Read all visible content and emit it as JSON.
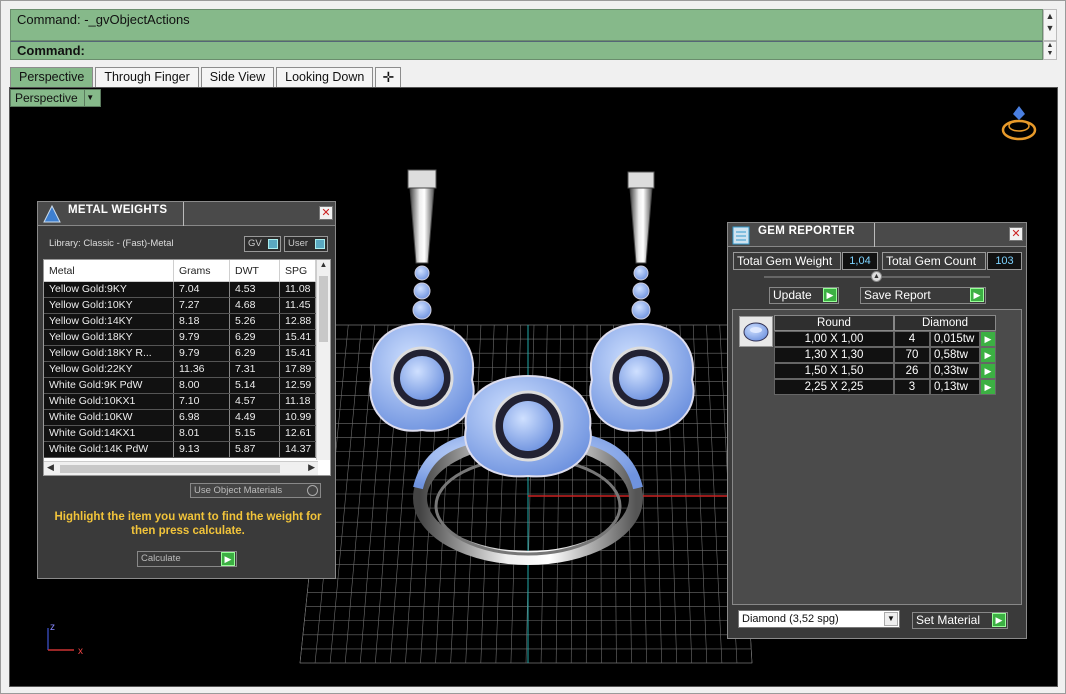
{
  "command": {
    "history": "Command: -_gvObjectActions",
    "prompt": "Command:"
  },
  "tabs": [
    "Perspective",
    "Through Finger",
    "Side View",
    "Looking Down"
  ],
  "viewport": {
    "label": "Perspective"
  },
  "axis": {
    "x": "x",
    "z": "z"
  },
  "metal_weights": {
    "title": "METAL WEIGHTS",
    "library": "Library: Classic - (Fast)-Metal",
    "toggle_gv": "GV",
    "toggle_user": "User",
    "columns": [
      "Metal",
      "Grams",
      "DWT",
      "SPG"
    ],
    "rows": [
      [
        "Yellow Gold:9KY",
        "7.04",
        "4.53",
        "11.08"
      ],
      [
        "Yellow Gold:10KY",
        "7.27",
        "4.68",
        "11.45"
      ],
      [
        "Yellow Gold:14KY",
        "8.18",
        "5.26",
        "12.88"
      ],
      [
        "Yellow Gold:18KY",
        "9.79",
        "6.29",
        "15.41"
      ],
      [
        "Yellow Gold:18KY R...",
        "9.79",
        "6.29",
        "15.41"
      ],
      [
        "Yellow Gold:22KY",
        "11.36",
        "7.31",
        "17.89"
      ],
      [
        "White Gold:9K PdW",
        "8.00",
        "5.14",
        "12.59"
      ],
      [
        "White Gold:10KX1",
        "7.10",
        "4.57",
        "11.18"
      ],
      [
        "White Gold:10KW",
        "6.98",
        "4.49",
        "10.99"
      ],
      [
        "White Gold:14KX1",
        "8.01",
        "5.15",
        "12.61"
      ],
      [
        "White Gold:14K PdW",
        "9.13",
        "5.87",
        "14.37"
      ]
    ],
    "use_object_materials": "Use Object Materials",
    "hint": "Highlight the item you want to find the weight for then press calculate.",
    "calculate": "Calculate"
  },
  "gem_reporter": {
    "title": "GEM REPORTER",
    "total_weight_label": "Total Gem Weight",
    "total_weight": "1,04",
    "total_count_label": "Total Gem Count",
    "total_count": "103",
    "update": "Update",
    "save_report": "Save Report",
    "columns": [
      "Round",
      "Diamond"
    ],
    "rows": [
      [
        "1,00 X 1,00",
        "4",
        "0,015tw"
      ],
      [
        "1,30 X 1,30",
        "70",
        "0,58tw"
      ],
      [
        "1,50 X 1,50",
        "26",
        "0,33tw"
      ],
      [
        "2,25 X 2,25",
        "3",
        "0,13tw"
      ]
    ],
    "material": "Diamond     (3,52 spg)",
    "set_material": "Set Material"
  },
  "colors": {
    "accent_green": "#86b98a",
    "gem_blue": "#7fa4e8",
    "hint_yellow": "#f2c43a"
  }
}
